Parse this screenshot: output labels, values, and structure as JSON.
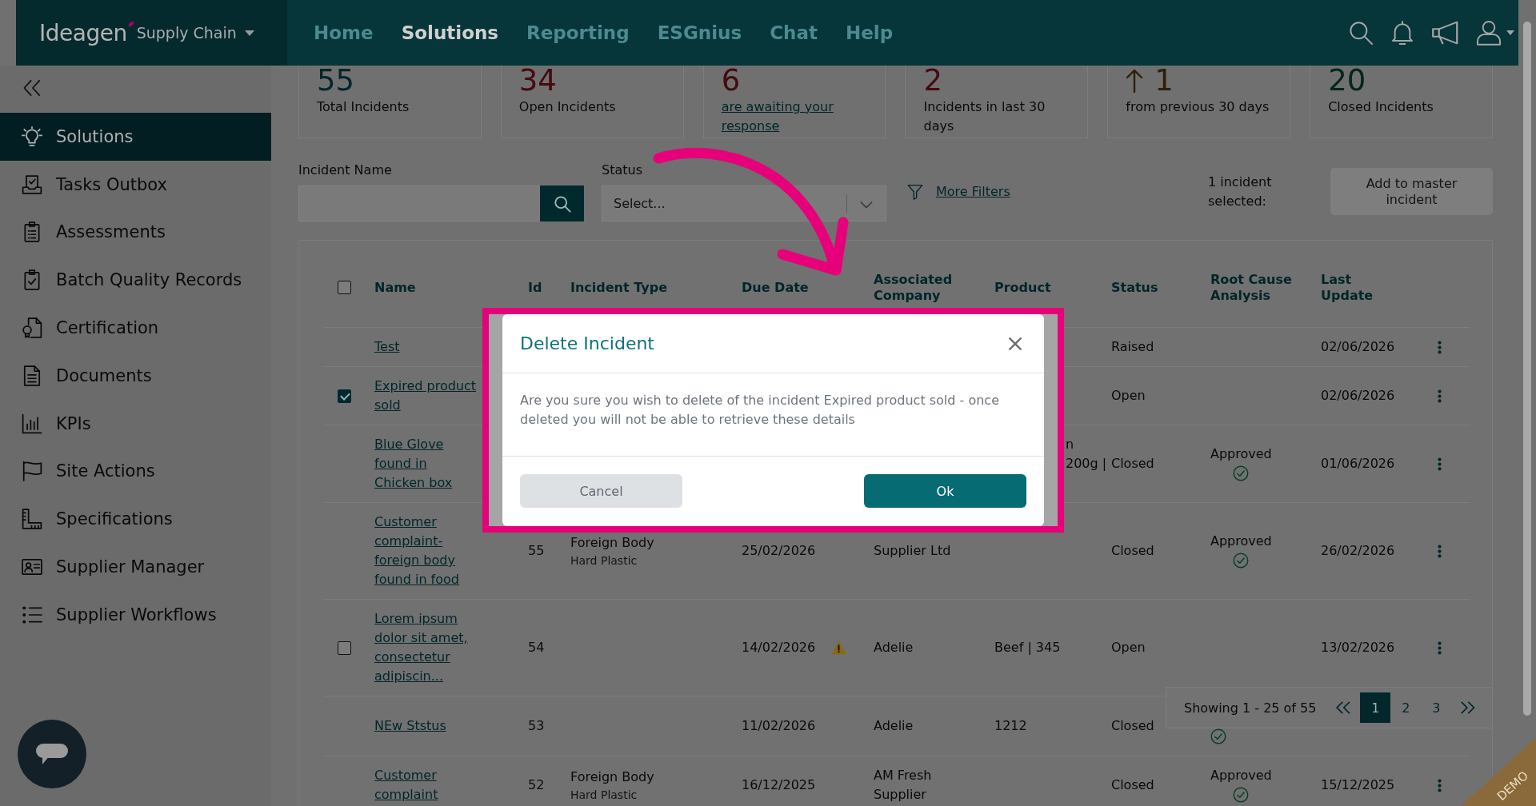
{
  "header": {
    "logo": "Ideagen",
    "product": "Supply Chain",
    "nav": [
      {
        "label": "Home",
        "selected": false
      },
      {
        "label": "Solutions",
        "selected": true
      },
      {
        "label": "Reporting",
        "selected": false
      },
      {
        "label": "ESGnius",
        "selected": false
      },
      {
        "label": "Chat",
        "selected": false
      },
      {
        "label": "Help",
        "selected": false
      }
    ]
  },
  "sidebar": {
    "items": [
      {
        "label": "Solutions",
        "selected": true
      },
      {
        "label": "Tasks Outbox",
        "selected": false
      },
      {
        "label": "Assessments",
        "selected": false
      },
      {
        "label": "Batch Quality Records",
        "selected": false
      },
      {
        "label": "Certification",
        "selected": false
      },
      {
        "label": "Documents",
        "selected": false
      },
      {
        "label": "KPIs",
        "selected": false
      },
      {
        "label": "Site Actions",
        "selected": false
      },
      {
        "label": "Specifications",
        "selected": false
      },
      {
        "label": "Supplier Manager",
        "selected": false
      },
      {
        "label": "Supplier Workflows",
        "selected": false
      }
    ]
  },
  "stats": [
    {
      "value": "55",
      "label": "Total Incidents",
      "kind": "plain",
      "color": "#00252a"
    },
    {
      "value": "34",
      "label": "Open Incidents",
      "kind": "plain",
      "color": "#440a0e"
    },
    {
      "value": "6",
      "label": "are awaiting your response",
      "kind": "link",
      "color": "#440a0e"
    },
    {
      "value": "2",
      "label": "Incidents in last 30 days",
      "kind": "plain",
      "color": "#440a0e"
    },
    {
      "value": "1",
      "label": "from previous 30 days",
      "kind": "trend",
      "color": "#2e2008"
    },
    {
      "value": "20",
      "label": "Closed Incidents",
      "kind": "plain",
      "color": "#02261a"
    }
  ],
  "filters": {
    "incident_name": {
      "label": "Incident Name"
    },
    "status": {
      "label": "Status",
      "placeholder": "Select..."
    },
    "more_filters": "More Filters",
    "selection": "1 incident selected:",
    "add_to_master": "Add to master incident"
  },
  "table": {
    "select_all": {
      "checked": false
    },
    "columns": [
      "Name",
      "Id",
      "Incident Type",
      "Due Date",
      "Associated Company",
      "Product",
      "Status",
      "Root Cause Analysis",
      "Last Update"
    ],
    "rows": [
      {
        "name": "Test",
        "status": "Raised",
        "rca_check": false,
        "last_update": "02/06/2026",
        "has_menu": true
      },
      {
        "checkbox": {
          "checked": true
        },
        "name": "Expired product sold",
        "status": "Open",
        "rca_check": false,
        "last_update": "02/06/2026",
        "has_menu": true
      },
      {
        "name": "Blue Glove found in Chicken box",
        "product_tail": [
          "n",
          "200g |"
        ],
        "status": "Closed",
        "rca": "Approved",
        "rca_check": true,
        "last_update": "01/06/2026",
        "has_menu": true
      },
      {
        "name": "Customer complaint- foreign body found in food",
        "id": "55",
        "type": "Foreign Body",
        "type_detail": "Hard Plastic",
        "due_date": "25/02/2026",
        "due_warning": false,
        "company": "Supplier Ltd",
        "status": "Closed",
        "rca": "Approved",
        "rca_check": true,
        "last_update": "26/02/2026",
        "has_menu": true
      },
      {
        "checkbox": {
          "checked": false
        },
        "name": "Lorem ipsum dolor sit amet, consectetur adipiscin...",
        "id": "54",
        "due_date": "14/02/2026",
        "due_warning": true,
        "company": "Adelie",
        "product": "Beef | 345",
        "status": "Open",
        "rca_check": false,
        "last_update": "13/02/2026",
        "has_menu": true
      },
      {
        "name": "NEw Ststus",
        "id": "53",
        "due_date": "11/02/2026",
        "due_warning": false,
        "company": "Adelie",
        "product": "1212",
        "status": "Closed",
        "rca_check": true,
        "has_menu": false
      },
      {
        "name": "Customer complaint",
        "id": "52",
        "type": "Foreign Body",
        "type_detail": "Hard Plastic",
        "due_date": "16/12/2025",
        "due_warning": false,
        "company": "AM Fresh Supplier",
        "status": "Closed",
        "rca": "Approved",
        "rca_check": true,
        "last_update": "15/12/2025",
        "has_menu": true
      }
    ]
  },
  "pagination": {
    "summary": "Showing 1 - 25 of 55",
    "pages": [
      {
        "label": "1",
        "selected": true
      },
      {
        "label": "2",
        "selected": false
      },
      {
        "label": "3",
        "selected": false
      }
    ]
  },
  "dialog": {
    "title": "Delete Incident",
    "message": "Are you sure you wish to delete of the incident Expired product sold - once deleted you will not be able to retrieve these details",
    "buttons": [
      {
        "label": "Cancel",
        "kind": "secondary"
      },
      {
        "label": "Ok",
        "kind": "primary"
      }
    ]
  },
  "demo_ribbon": {
    "label": "DEMO"
  }
}
